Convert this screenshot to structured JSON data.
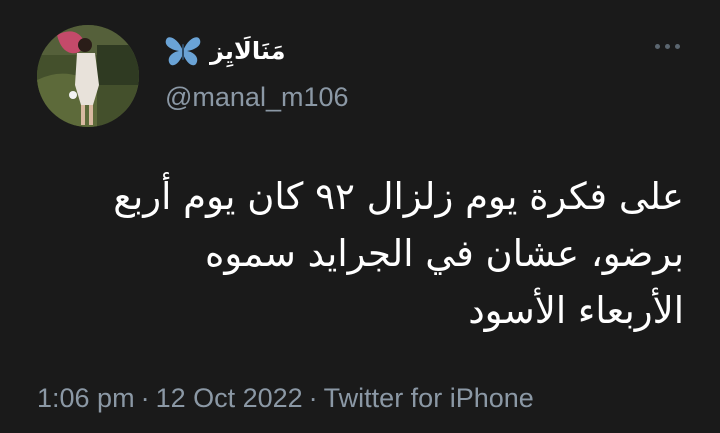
{
  "user": {
    "display_name": "مَنَالَايِز",
    "emoji_icon": "butterfly-icon",
    "handle": "@manal_m106"
  },
  "tweet": {
    "lines": [
      "على فكرة يوم زلزال ٩٢ كان يوم أربع",
      "برضو، عشان في الجرايد سموه",
      "الأربعاء الأسود"
    ]
  },
  "meta": {
    "time": "1:06 pm",
    "separator": "·",
    "date": "12 Oct 2022",
    "source": "Twitter for iPhone"
  },
  "colors": {
    "background": "#1a1a1a",
    "text": "#ffffff",
    "secondary": "#8b98a5",
    "butterfly": "#6aa3d6"
  }
}
